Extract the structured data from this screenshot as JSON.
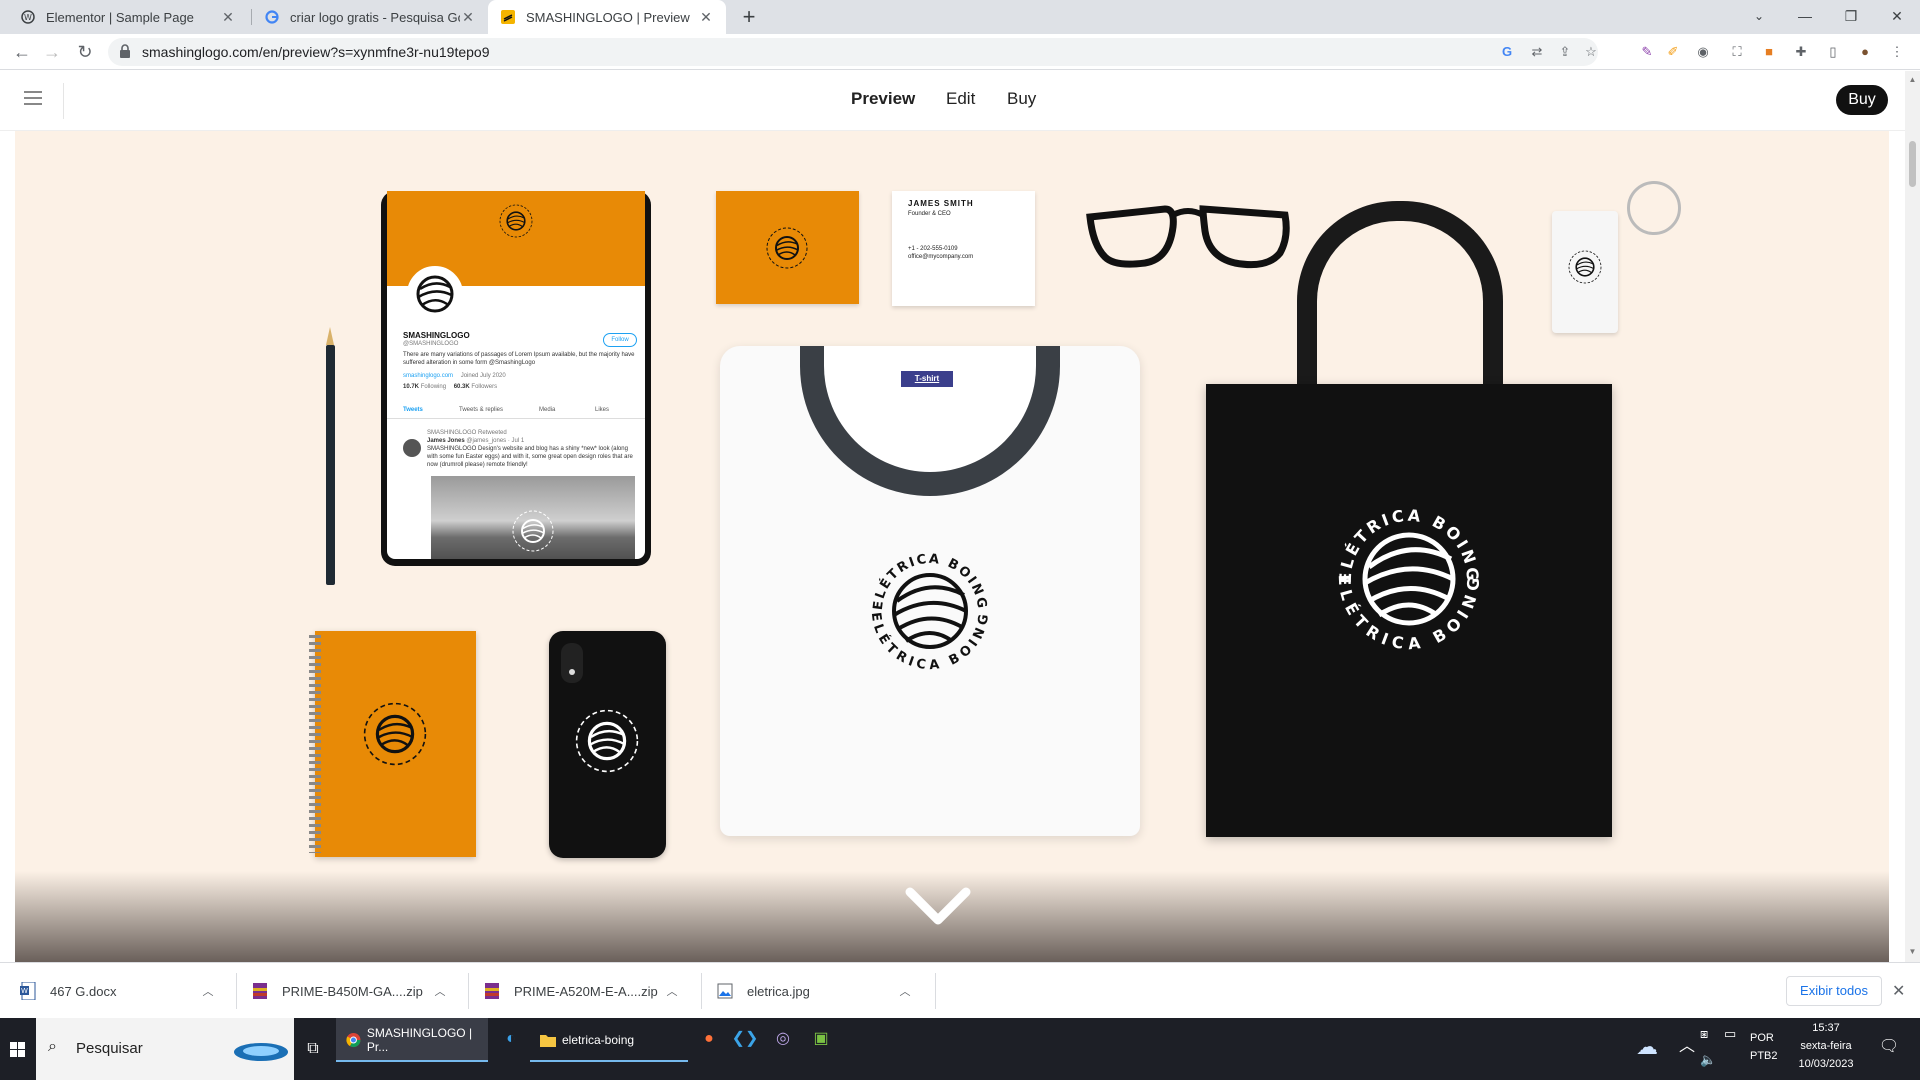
{
  "browser": {
    "tabs": [
      {
        "title": "Elementor | Sample Page",
        "favicon": "wordpress-icon",
        "active": false
      },
      {
        "title": "criar logo gratis - Pesquisa Goog",
        "favicon": "google-icon",
        "active": false
      },
      {
        "title": "SMASHINGLOGO | Preview",
        "favicon": "smashinglogo-icon",
        "active": true
      }
    ],
    "url": "smashinglogo.com/en/preview?s=xynmfne3r-nu19tepo9"
  },
  "site_header": {
    "nav": [
      "Preview",
      "Edit",
      "Buy"
    ],
    "active_nav": "Preview",
    "buy_button": "Buy"
  },
  "mockups": {
    "twitter": {
      "name": "SMASHINGLOGO",
      "handle": "@SMASHINGLOGO",
      "bio": "There are many variations of passages of Lorem Ipsum available, but the majority have suffered alteration in some form @SmashingLogo",
      "website": "smashinglogo.com",
      "joined": "Joined July 2020",
      "following": "10.7K",
      "following_label": "Following",
      "followers": "60.3K",
      "followers_label": "Followers",
      "follow_button": "Follow",
      "tabs": [
        "Tweets",
        "Tweets & replies",
        "Media",
        "Likes"
      ],
      "retweet_label": "SMASHINGLOGO Retweeted",
      "tweet_author": "James Jones",
      "tweet_meta": "@james_jones · Jul 1",
      "tweet_text": "SMASHINGLOGO Design's website and blog has a shiny *new* look (along with some fun Easter eggs) and with it, some great open design roles that are now (drumroll please) remote friendly!"
    },
    "business_card": {
      "name": "JAMES SMITH",
      "role": "Founder & CEO",
      "phone": "+1 - 202-555-0109",
      "email": "office@mycompany.com"
    },
    "tshirt_tag": "T-shirt",
    "logo_text": "ELÉTRICA BOING"
  },
  "downloads": {
    "items": [
      {
        "name": "467 G.docx",
        "icon": "word-doc-icon"
      },
      {
        "name": "PRIME-B450M-GA....zip",
        "icon": "winrar-icon"
      },
      {
        "name": "PRIME-A520M-E-A....zip",
        "icon": "winrar-icon"
      },
      {
        "name": "eletrica.jpg",
        "icon": "image-file-icon"
      }
    ],
    "show_all": "Exibir todos"
  },
  "taskbar": {
    "search_placeholder": "Pesquisar",
    "apps": [
      {
        "label": "SMASHINGLOGO | Pr...",
        "icon": "chrome-icon",
        "active": true
      },
      {
        "label": "eletrica-boing",
        "icon": "folder-icon",
        "active": false
      }
    ],
    "language": "POR",
    "keyboard": "PTB2",
    "time": "15:37",
    "day": "sexta-feira",
    "date": "10/03/2023"
  },
  "colors": {
    "brand_orange": "#e88a06",
    "canvas_bg": "#fcf1e6",
    "tab_bar": "#dee1e6",
    "taskbar": "#1d1f26"
  }
}
